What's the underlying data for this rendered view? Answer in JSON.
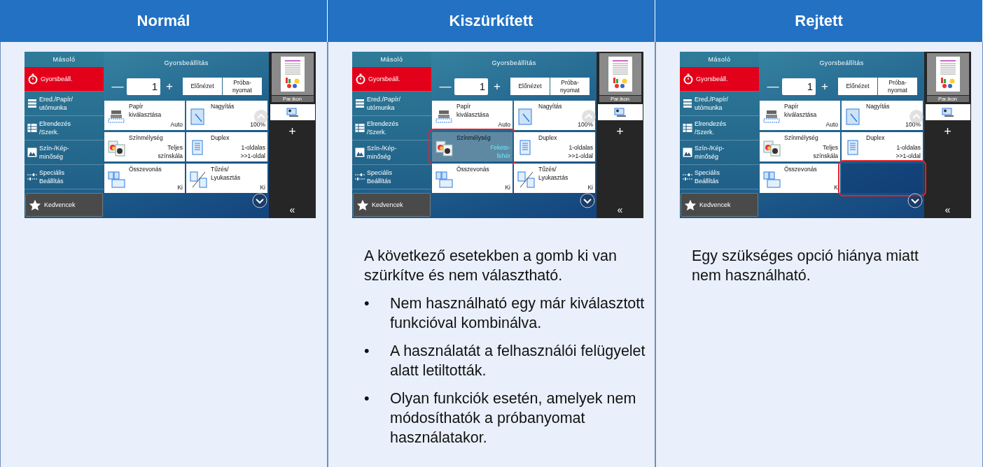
{
  "columns": [
    {
      "header": "Normál",
      "screen": {
        "title": "Másoló",
        "nav": [
          {
            "label": "Gyorsbeáll.",
            "selected": true
          },
          {
            "label": "Ered./Papír/\nutómunka",
            "selected": false
          },
          {
            "label": "Elrendezés\n/Szerk.",
            "selected": false
          },
          {
            "label": "Szín-/Kép-\nminőség",
            "selected": false
          },
          {
            "label": "Speciális\nBeállítás",
            "selected": false
          }
        ],
        "favorites": "Kedvencek",
        "main_title": "Gyorsbeállítás",
        "minus": "—",
        "copies": "1",
        "plus": "+",
        "preview_button": "Előnézet",
        "proof_button": "Próba-\nnyomat",
        "tiles": [
          {
            "title": "Papír\nkiválasztása",
            "value": "Auto",
            "grayed": false,
            "hidden": false,
            "highlighted": false
          },
          {
            "title": "Nagyítás",
            "value": "100%",
            "grayed": false,
            "hidden": false,
            "highlighted": false
          },
          {
            "title": "Színmélység",
            "value": "Teljes\nszínskála",
            "grayed": false,
            "hidden": false,
            "highlighted": false
          },
          {
            "title": "Duplex",
            "value": "1-oldalas\n>>1-oldal",
            "grayed": false,
            "hidden": false,
            "highlighted": false
          },
          {
            "title": "Összevonás",
            "value": "Ki",
            "grayed": false,
            "hidden": false,
            "highlighted": false
          },
          {
            "title": "Tűzés/\nLyukasztás",
            "value": "Ki",
            "grayed": false,
            "hidden": false,
            "highlighted": false
          }
        ],
        "thumbnail_label": "Par.ikon",
        "add": "+",
        "collapse": "«"
      }
    },
    {
      "header": "Kiszürkített",
      "screen": {
        "title": "Másoló",
        "nav": [
          {
            "label": "Gyorsbeáll.",
            "selected": true
          },
          {
            "label": "Ered./Papír/\nutómunka",
            "selected": false
          },
          {
            "label": "Elrendezés\n/Szerk.",
            "selected": false
          },
          {
            "label": "Szín-/Kép-\nminőség",
            "selected": false
          },
          {
            "label": "Speciális\nBeállítás",
            "selected": false
          }
        ],
        "favorites": "Kedvencek",
        "main_title": "Gyorsbeállítás",
        "minus": "—",
        "copies": "1",
        "plus": "+",
        "preview_button": "Előnézet",
        "proof_button": "Próba-\nnyomat",
        "tiles": [
          {
            "title": "Papír\nkiválasztása",
            "value": "Auto",
            "grayed": false,
            "hidden": false,
            "highlighted": false
          },
          {
            "title": "Nagyítás",
            "value": "100%",
            "grayed": false,
            "hidden": false,
            "highlighted": false
          },
          {
            "title": "Színmélység",
            "value": "Fekete-\nfehér",
            "grayed": true,
            "hidden": false,
            "highlighted": true
          },
          {
            "title": "Duplex",
            "value": "1-oldalas\n>>1-oldal",
            "grayed": false,
            "hidden": false,
            "highlighted": false
          },
          {
            "title": "Összevonás",
            "value": "Ki",
            "grayed": false,
            "hidden": false,
            "highlighted": false
          },
          {
            "title": "Tűzés/\nLyukasztás",
            "value": "Ki",
            "grayed": false,
            "hidden": false,
            "highlighted": false
          }
        ],
        "thumbnail_label": "Par.ikon",
        "add": "+",
        "collapse": "«"
      },
      "description": "A következő esetekben a gomb ki van szürkítve és nem választható.",
      "bullets": [
        {
          "mark": "•",
          "text": "Nem használható egy már kiválasztott funkcióval kombinálva."
        },
        {
          "mark": "•",
          "text": "A használatát a felhasználói felügyelet alatt letiltották."
        },
        {
          "mark": "•",
          "text": "Olyan funkciók esetén, amelyek nem módosíthatók a próbanyomat használatakor."
        }
      ]
    },
    {
      "header": "Rejtett",
      "screen": {
        "title": "Másoló",
        "nav": [
          {
            "label": "Gyorsbeáll.",
            "selected": true
          },
          {
            "label": "Ered./Papír/\nutómunka",
            "selected": false
          },
          {
            "label": "Elrendezés\n/Szerk.",
            "selected": false
          },
          {
            "label": "Szín-/Kép-\nminőség",
            "selected": false
          },
          {
            "label": "Speciális\nBeállítás",
            "selected": false
          }
        ],
        "favorites": "Kedvencek",
        "main_title": "Gyorsbeállítás",
        "minus": "—",
        "copies": "1",
        "plus": "+",
        "preview_button": "Előnézet",
        "proof_button": "Próba-\nnyomat",
        "tiles": [
          {
            "title": "Papír\nkiválasztása",
            "value": "Auto",
            "grayed": false,
            "hidden": false,
            "highlighted": false
          },
          {
            "title": "Nagyítás",
            "value": "100%",
            "grayed": false,
            "hidden": false,
            "highlighted": false
          },
          {
            "title": "Színmélység",
            "value": "Teljes\nszínskála",
            "grayed": false,
            "hidden": false,
            "highlighted": false
          },
          {
            "title": "Duplex",
            "value": "1-oldalas\n>>1-oldal",
            "grayed": false,
            "hidden": false,
            "highlighted": false
          },
          {
            "title": "Összevonás",
            "value": "K",
            "grayed": false,
            "hidden": false,
            "highlighted": false
          },
          {
            "grayed": false,
            "hidden": true,
            "highlighted": true
          }
        ],
        "thumbnail_label": "Par.ikon",
        "add": "+",
        "collapse": "«"
      },
      "description": "Egy szükséges opció hiánya miatt nem használható."
    }
  ]
}
